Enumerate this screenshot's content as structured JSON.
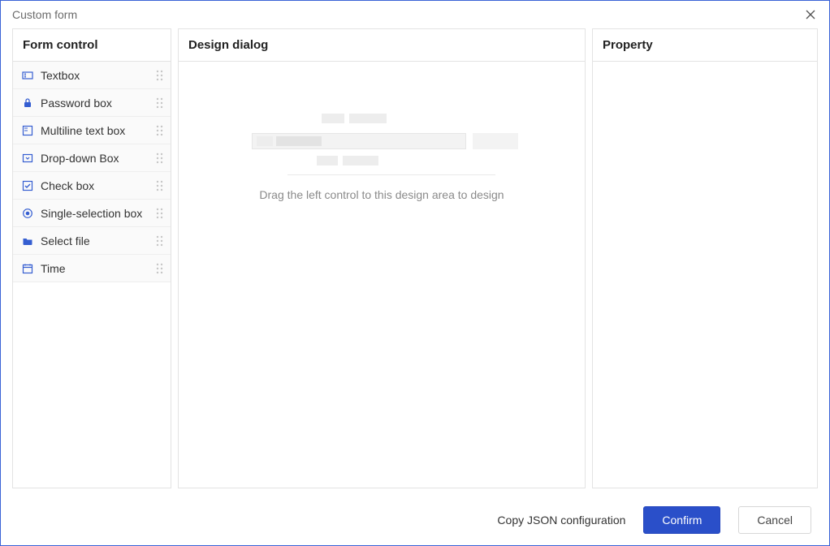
{
  "window": {
    "title": "Custom form"
  },
  "panels": {
    "left": {
      "title": "Form control"
    },
    "middle": {
      "title": "Design dialog",
      "placeholder": "Drag the left control to this design area to design"
    },
    "right": {
      "title": "Property"
    }
  },
  "controls": [
    {
      "icon": "textbox-icon",
      "label": "Textbox"
    },
    {
      "icon": "lock-icon",
      "label": "Password box"
    },
    {
      "icon": "multiline-icon",
      "label": "Multiline text box"
    },
    {
      "icon": "dropdown-icon",
      "label": "Drop-down Box"
    },
    {
      "icon": "checkbox-icon",
      "label": "Check box"
    },
    {
      "icon": "radio-icon",
      "label": "Single-selection box"
    },
    {
      "icon": "folder-icon",
      "label": "Select file"
    },
    {
      "icon": "calendar-icon",
      "label": "Time"
    }
  ],
  "footer": {
    "copy": "Copy JSON configuration",
    "confirm": "Confirm",
    "cancel": "Cancel"
  }
}
